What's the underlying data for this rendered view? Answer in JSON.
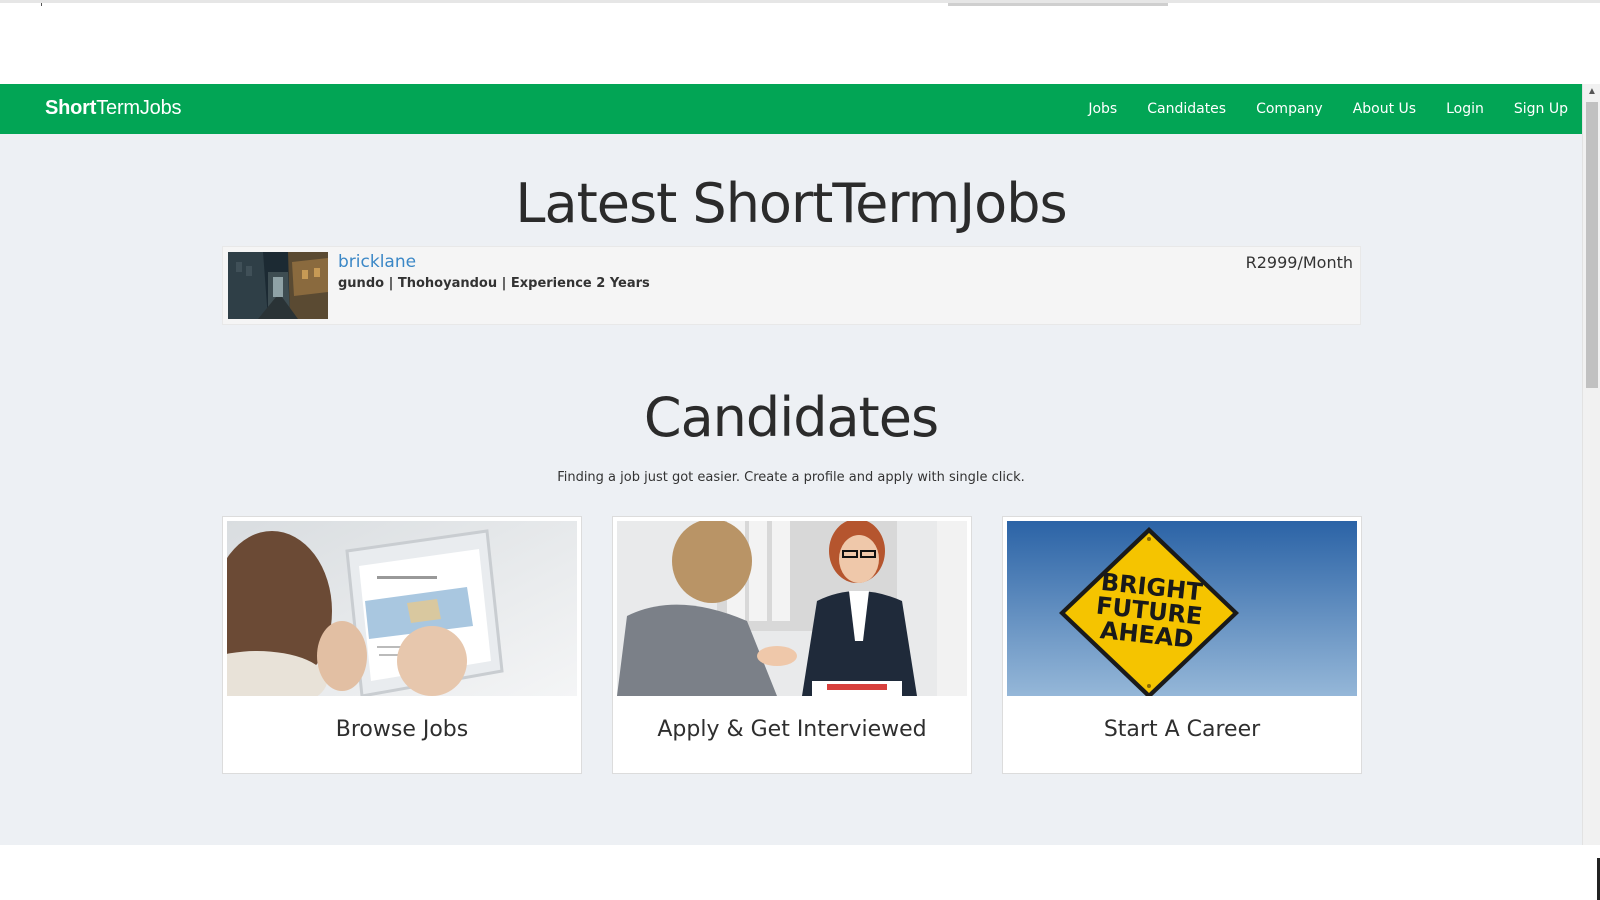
{
  "brand": {
    "part1": "Short",
    "part2": "TermJobs"
  },
  "nav": {
    "items": [
      "Jobs",
      "Candidates",
      "Company",
      "About Us",
      "Login",
      "Sign Up"
    ]
  },
  "latest": {
    "title": "Latest ShortTermJobs",
    "job": {
      "title": "bricklane",
      "meta": "gundo | Thohoyandou | Experience 2 Years",
      "salary": "R2999/Month"
    }
  },
  "candidates": {
    "title": "Candidates",
    "subtitle": "Finding a job just got easier. Create a profile and apply with single click.",
    "cards": [
      {
        "label": "Browse Jobs",
        "icon": "tablet-map-photo"
      },
      {
        "label": "Apply & Get Interviewed",
        "icon": "interview-handshake-photo"
      },
      {
        "label": "Start A Career",
        "icon": "road-sign-photo",
        "sign_text": [
          "BRIGHT",
          "FUTURE",
          "AHEAD"
        ]
      }
    ]
  },
  "colors": {
    "navbar": "#02a555",
    "page_bg": "#edf0f4",
    "link": "#3a87c6",
    "sign_yellow": "#f5c400"
  }
}
